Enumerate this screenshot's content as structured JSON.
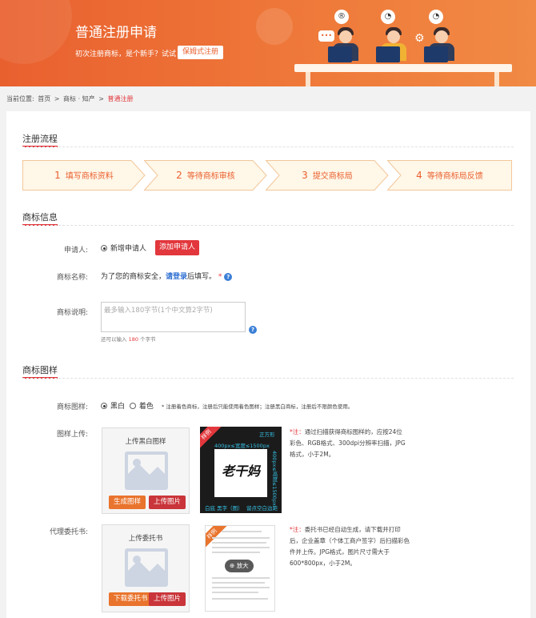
{
  "banner": {
    "title": "普通注册申请",
    "subtitle": "初次注册商标，是个新手？试试",
    "button": "保姆式注册",
    "icons": {
      "registered": "®",
      "chat": "•••"
    }
  },
  "breadcrumb": {
    "prefix": "当前位置:",
    "home": "首页",
    "sep": ">",
    "middle": "商标 · 知产",
    "current": "普通注册"
  },
  "flow": {
    "title": "注册流程",
    "steps": [
      {
        "num": "1",
        "label": "填写商标资料"
      },
      {
        "num": "2",
        "label": "等待商标审核"
      },
      {
        "num": "3",
        "label": "提交商标局"
      },
      {
        "num": "4",
        "label": "等待商标局反馈"
      }
    ]
  },
  "info": {
    "title": "商标信息",
    "applicant_label": "申请人:",
    "applicant_option": "新增申请人",
    "add_applicant_btn": "添加申请人",
    "name_label": "商标名称:",
    "name_text_pre": "为了您的商标安全，",
    "login_link": "请登录",
    "name_text_post": "后填写。",
    "required_mark": "*",
    "help_mark": "?",
    "desc_label": "商标说明:",
    "desc_placeholder": "最多输入180字节(1个中文算2字节)",
    "desc_hint_pre": "还可以输入",
    "desc_hint_count": "180",
    "desc_hint_post": "个字节"
  },
  "pattern": {
    "title": "商标图样",
    "type_label": "商标图样:",
    "opt_bw": "黑白",
    "opt_color": "着色",
    "type_note": "* 注册着色商标，注册后只能使用着色图样；注册黑白商标，注册后不限颜色使用。",
    "upload_label": "图样上传:",
    "upload_box_title": "上传黑白图样",
    "gen_btn": "生成图样",
    "upload_btn": "上传图片",
    "sample_ribbon": "样例",
    "sample_square": "正方形",
    "sample_width": "400px≤宽度≤1500px",
    "sample_height": "400px≤高度≤1500px",
    "sample_signature": "老干妈",
    "sample_bottom_left": "白底 黑字（图）",
    "sample_bottom_right": "留点空白边距",
    "upload_note_mark": "*注：",
    "upload_note": "通过扫描获得商标图样的，应按24位彩色、RGB格式、300dpi分辨率扫描，JPG格式，小于2M。",
    "proxy_label": "代理委托书:",
    "proxy_box_title": "上传委托书",
    "download_btn": "下载委托书",
    "proxy_upload_btn": "上传图片",
    "proxy_note_mark": "*注：",
    "proxy_note": "委托书已经自动生成，请下载并打印后，企业盖章（个体工商户签字）后扫描彩色件并上传。JPG格式，图片尺寸需大于600*800px，小于2M。",
    "zoom_btn": "放大"
  },
  "colors": {
    "brand": "#e9602f",
    "red": "#e2373c",
    "link": "#2f6fd1"
  }
}
